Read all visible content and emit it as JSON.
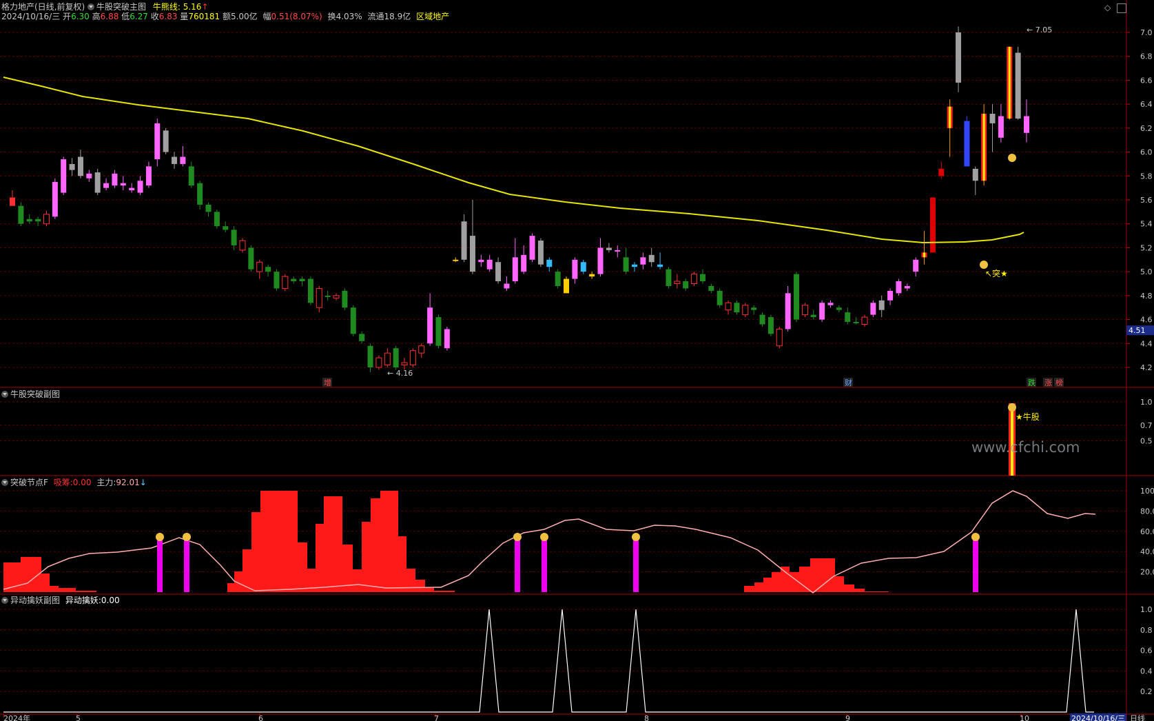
{
  "header": {
    "stock_name": "格力地产(日线,前复权)",
    "indicator_name": "牛股突破主图",
    "bull_line_label": "牛熊线: 5.16",
    "bull_line_arrow": "↑",
    "date": "2024/10/16/三",
    "open_label": "开",
    "open": "6.30",
    "high_label": "高",
    "high": "6.88",
    "low_label": "低",
    "low": "6.27",
    "close_label": "收",
    "close": "6.83",
    "volume_label": "量",
    "volume": "760181",
    "amount": "额5.00亿",
    "change_label": "幅",
    "change": "0.51(8.07%)",
    "turnover": "换4.03%",
    "float_cap": "流通18.9亿",
    "sector": "区域地产"
  },
  "main_panel": {
    "y_ticks": [
      "7.0",
      "6.8",
      "6.6",
      "6.4",
      "6.2",
      "6.0",
      "5.8",
      "5.6",
      "5.4",
      "5.2",
      "5.0",
      "4.8",
      "4.6",
      "4.4",
      "4.2"
    ],
    "high_marker": "7.05",
    "low_marker": "4.16",
    "current_price_tag": "4.51",
    "break_marker": "突★",
    "event_labels": [
      {
        "text": "增",
        "color": "#ff4a4a"
      },
      {
        "text": "财",
        "color": "#66aaff"
      },
      {
        "text": "跌",
        "color": "#33dd33"
      },
      {
        "text": "涨",
        "color": "#ff4a4a"
      },
      {
        "text": "榜",
        "color": "#ff4a4a"
      }
    ]
  },
  "panel2": {
    "title": "牛股突破副图",
    "y_ticks": [
      "1.0",
      "0.7",
      "0.5"
    ],
    "signal_label": "★牛股",
    "watermark": "www.cfchi.com"
  },
  "panel3": {
    "title": "突破节点F",
    "item1_label": "吸筹:",
    "item1_value": "0.00",
    "item2_label": "主力:",
    "item2_value": "92.01",
    "item2_arrow": "↓",
    "y_ticks": [
      "100.",
      "80.0",
      "60.0",
      "40.0",
      "20.0"
    ]
  },
  "panel4": {
    "title": "异动擒妖副图",
    "item_label": "异动擒妖:",
    "item_value": "0.00",
    "y_ticks": [
      "1.0",
      "0.8",
      "0.6",
      "0.4",
      "0.2"
    ]
  },
  "x_axis": {
    "labels": [
      "2024年",
      "5",
      "6",
      "7",
      "8",
      "9",
      "10"
    ],
    "current_date": "2024/10/16/三",
    "period": "日线"
  },
  "colors": {
    "up": "#ff4a4a",
    "down": "#2aa02a",
    "ma_line": "#e6e600",
    "grid": "#5a0000",
    "panel_border": "#a00000"
  }
}
